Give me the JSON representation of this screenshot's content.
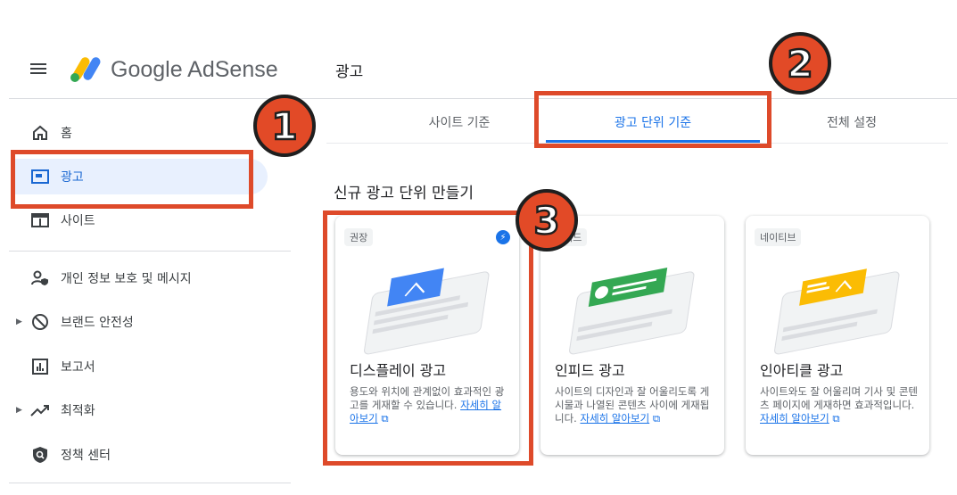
{
  "header": {
    "brand": "Google AdSense",
    "page_title": "광고"
  },
  "sidebar": {
    "items": [
      {
        "label": "홈",
        "icon": "home-icon"
      },
      {
        "label": "광고",
        "icon": "ads-icon",
        "active": true
      },
      {
        "label": "사이트",
        "icon": "sites-icon"
      },
      {
        "label": "개인 정보 보호 및 메시지",
        "icon": "privacy-icon"
      },
      {
        "label": "브랜드 안전성",
        "icon": "block-icon",
        "expandable": true
      },
      {
        "label": "보고서",
        "icon": "reports-icon"
      },
      {
        "label": "최적화",
        "icon": "trending-icon",
        "expandable": true
      },
      {
        "label": "정책 센터",
        "icon": "policy-icon"
      }
    ]
  },
  "tabs": [
    {
      "label": "사이트 기준"
    },
    {
      "label": "광고 단위 기준",
      "active": true
    },
    {
      "label": "전체 설정"
    }
  ],
  "section_title": "신규 광고 단위 만들기",
  "cards": [
    {
      "chip": "권장",
      "title": "디스플레이 광고",
      "desc": "용도와 위치에 관계없이 효과적인 광고를 게재할 수 있습니다.",
      "link": "자세히 알아보기",
      "accent": "#4285f4"
    },
    {
      "chip": "인피드",
      "title": "인피드 광고",
      "desc": "사이트의 디자인과 잘 어울리도록 게시물과 나열된 콘텐츠 사이에 게재됩니다.",
      "link": "자세히 알아보기",
      "accent": "#34a853"
    },
    {
      "chip": "네이티브",
      "title": "인아티클 광고",
      "desc": "사이트와도 잘 어울리며 기사 및 콘텐츠 페이지에 게재하면 효과적입니다.",
      "link": "자세히 알아보기",
      "accent": "#fbbc04"
    }
  ],
  "annotations": {
    "badge_1": "1",
    "badge_2": "2",
    "badge_3": "3",
    "color": "#de4a2a"
  }
}
